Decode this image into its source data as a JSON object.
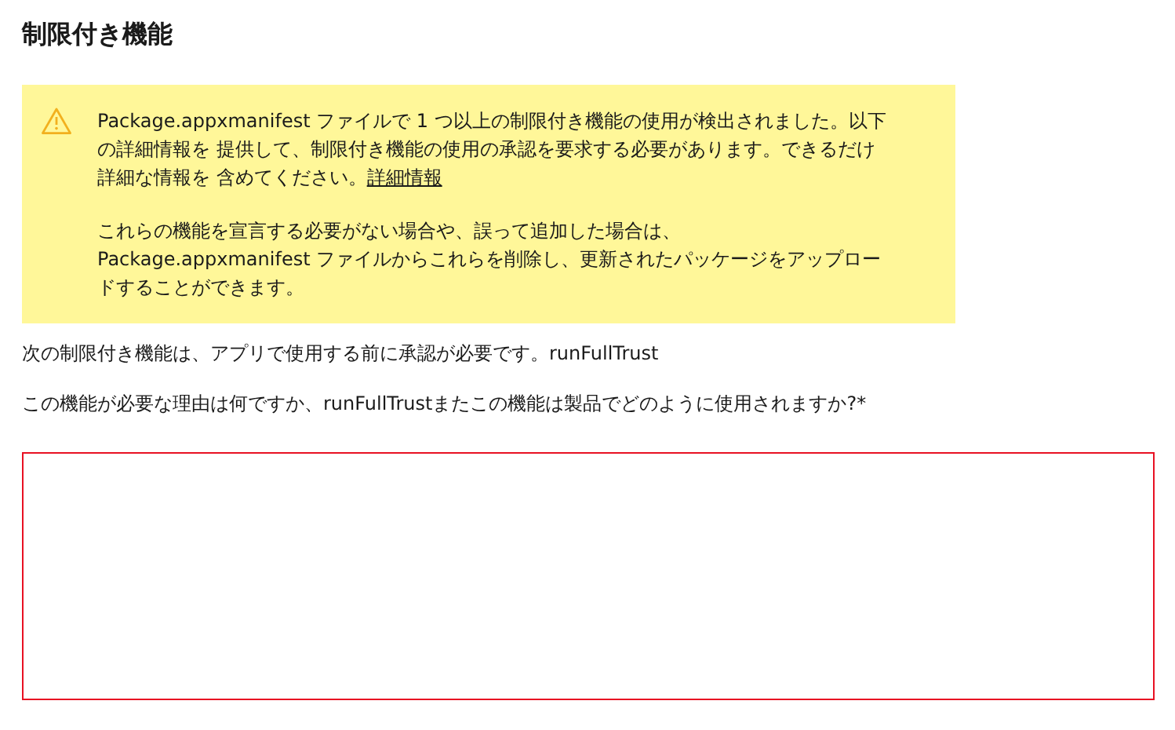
{
  "heading": "制限付き機能",
  "warning": {
    "paragraphs": [
      {
        "text": "Package.appxmanifest ファイルで 1 つ以上の制限付き機能の使用が検出されました。以下の詳細情報を 提供して、制限付き機能の使用の承認を要求する必要があります。できるだけ詳細な情報を 含めてください。",
        "link": "詳細情報"
      },
      {
        "text": "これらの機能を宣言する必要がない場合や、誤って追加した場合は、Package.appxmanifest ファイルからこれらを削除し、更新されたパッケージをアップロードすることができます。"
      }
    ]
  },
  "capabilities_note": "次の制限付き機能は、アプリで使用する前に承認が必要です。runFullTrust",
  "question": {
    "label": "この機能が必要な理由は何ですか、runFullTrustまたこの機能は製品でどのように使用されますか?*",
    "error": true
  }
}
